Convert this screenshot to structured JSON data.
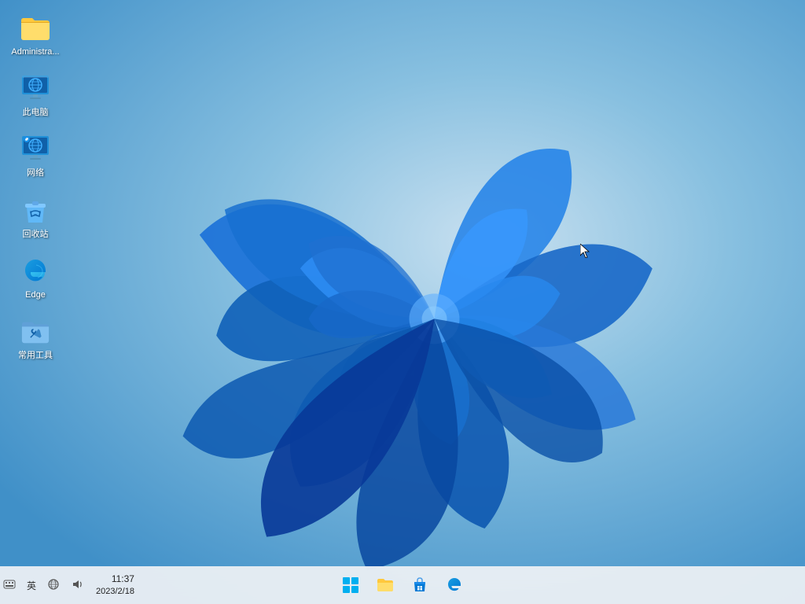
{
  "desktop": {
    "icons": [
      {
        "id": "administrator",
        "label": "Administra...",
        "type": "folder"
      },
      {
        "id": "this-pc",
        "label": "此电脑",
        "type": "monitor"
      },
      {
        "id": "network",
        "label": "网络",
        "type": "network"
      },
      {
        "id": "recycle",
        "label": "回收站",
        "type": "recycle"
      },
      {
        "id": "edge",
        "label": "Edge",
        "type": "edge"
      },
      {
        "id": "tools",
        "label": "常用工具",
        "type": "tools"
      }
    ]
  },
  "taskbar": {
    "items": [
      {
        "id": "start",
        "label": "开始"
      },
      {
        "id": "explorer",
        "label": "文件资源管理器"
      },
      {
        "id": "store",
        "label": "Microsoft Store"
      },
      {
        "id": "edge",
        "label": "Microsoft Edge"
      }
    ],
    "tray": {
      "keyboard": "英",
      "network": "网络",
      "volume": "音量",
      "time": "11:37",
      "date": "2023/2/18"
    }
  }
}
